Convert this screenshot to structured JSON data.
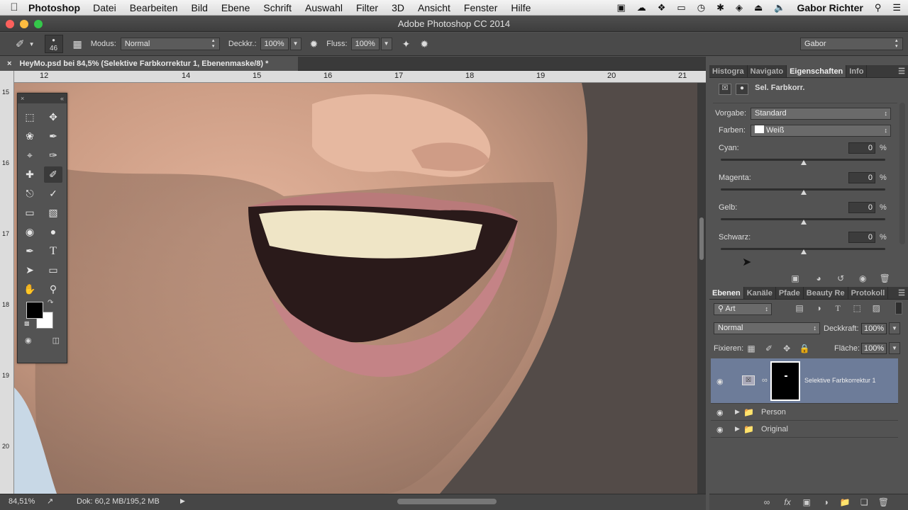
{
  "menubar": {
    "app": "Photoshop",
    "items": [
      "Datei",
      "Bearbeiten",
      "Bild",
      "Ebene",
      "Schrift",
      "Auswahl",
      "Filter",
      "3D",
      "Ansicht",
      "Fenster",
      "Hilfe"
    ],
    "user": "Gabor Richter"
  },
  "window": {
    "title": "Adobe Photoshop CC 2014"
  },
  "options": {
    "brush_size": "46",
    "mode_label": "Modus:",
    "mode_value": "Normal",
    "opacity_label": "Deckkr.:",
    "opacity_value": "100%",
    "flow_label": "Fluss:",
    "flow_value": "100%",
    "workspace": "Gabor"
  },
  "document": {
    "tab_title": "HeyMo.psd bei 84,5% (Selektive Farbkorrektur 1, Ebenenmaske/8) *",
    "ruler_h": [
      "12",
      "14",
      "15",
      "16",
      "17",
      "18",
      "19",
      "20",
      "21"
    ],
    "ruler_v": [
      "15",
      "16",
      "17",
      "18",
      "19",
      "20"
    ]
  },
  "status": {
    "zoom": "84,51%",
    "doc": "Dok: 60,2 MB/195,2 MB"
  },
  "properties": {
    "tabs": [
      "Histogra",
      "Navigato",
      "Eigenschaften",
      "Info"
    ],
    "title": "Sel. Farbkorr.",
    "preset_label": "Vorgabe:",
    "preset_value": "Standard",
    "colors_label": "Farben:",
    "colors_value": "Weiß",
    "sliders": [
      {
        "label": "Cyan:",
        "value": "0",
        "unit": "%"
      },
      {
        "label": "Magenta:",
        "value": "0",
        "unit": "%"
      },
      {
        "label": "Gelb:",
        "value": "0",
        "unit": "%"
      },
      {
        "label": "Schwarz:",
        "value": "0",
        "unit": "%"
      }
    ]
  },
  "layers": {
    "tabs": [
      "Ebenen",
      "Kanäle",
      "Pfade",
      "Beauty Re",
      "Protokoll"
    ],
    "filter_label": "Art",
    "blend_mode": "Normal",
    "opacity_label": "Deckkraft:",
    "opacity_value": "100%",
    "lock_label": "Fixieren:",
    "fill_label": "Fläche:",
    "fill_value": "100%",
    "items": [
      {
        "name": "Selektive Farbkorrektur 1"
      },
      {
        "name": "Person"
      },
      {
        "name": "Original"
      }
    ]
  },
  "colors": {
    "accent_selected_layer": "#6d7c99",
    "panel_bg": "#535353",
    "dark_bg": "#3a3a3a"
  }
}
